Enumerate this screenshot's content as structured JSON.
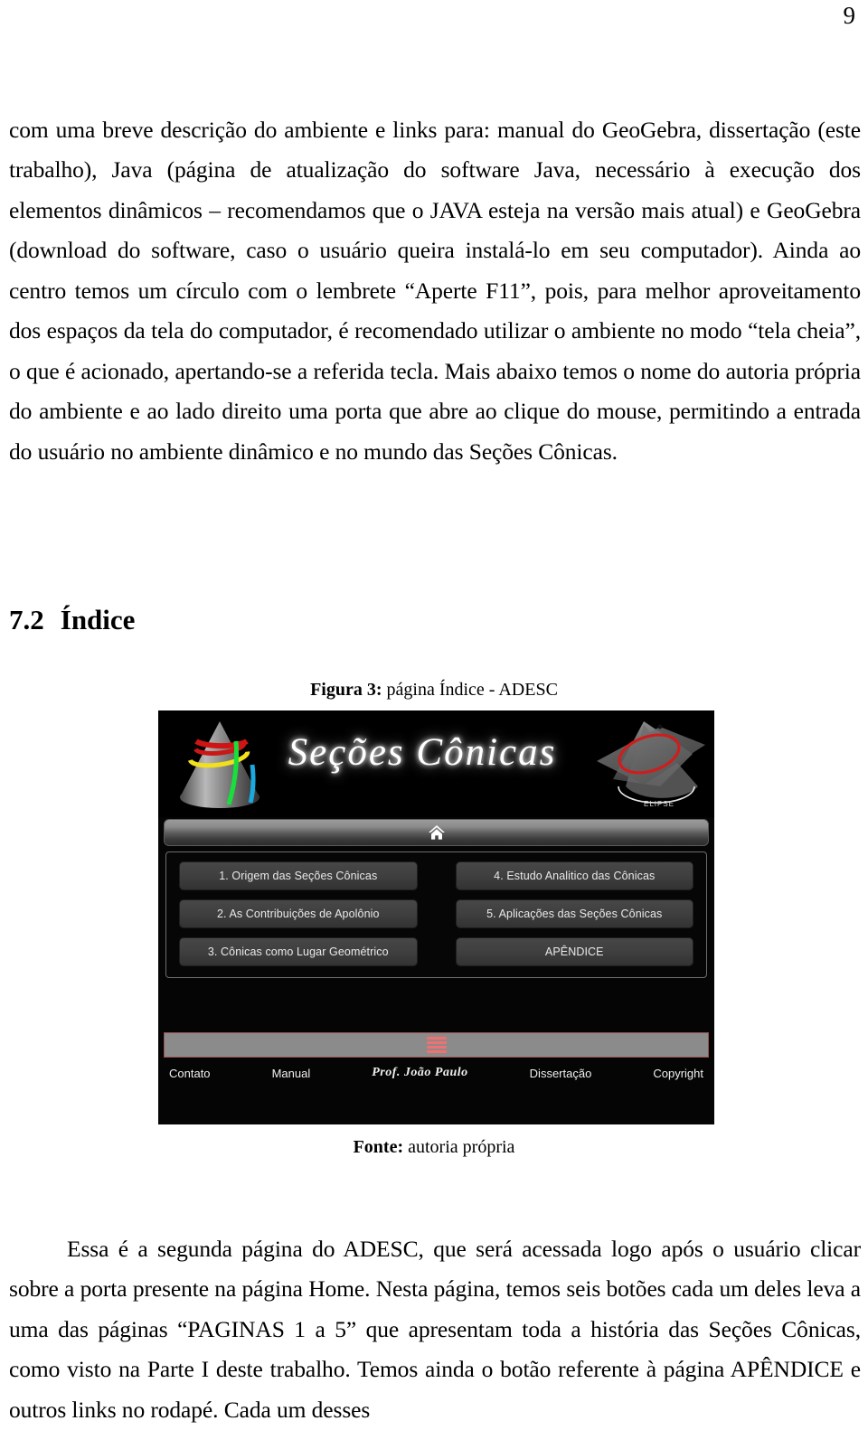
{
  "page": {
    "number": "9"
  },
  "paragraphs": {
    "first": "com uma breve descrição do ambiente e links para: manual do GeoGebra, dissertação (este trabalho), Java (página de atualização do software Java, necessário à execução dos elementos dinâmicos – recomendamos que o JAVA esteja na versão mais atual) e GeoGebra (download do software, caso o usuário queira instalá-lo em seu computador). Ainda ao centro temos um círculo com o lembrete “Aperte F11”, pois, para melhor aproveitamento dos espaços da tela do computador, é recomendado utilizar o ambiente no modo “tela cheia”, o que é acionado, apertando-se a referida tecla. Mais abaixo temos o nome do autoria própria do ambiente e ao lado direito uma porta que abre ao clique do mouse, permitindo a entrada do usuário no ambiente dinâmico e no mundo das Seções Cônicas.",
    "second": "Essa é a segunda página do ADESC, que será acessada logo após o usuário clicar sobre a porta presente na página Home. Nesta página, temos seis botões cada um deles leva a uma das páginas “PAGINAS 1 a 5” que apresentam toda a história das Seções Cônicas, como visto na Parte I deste trabalho. Temos ainda o botão referente à página APÊNDICE e outros links no rodapé. Cada um desses"
  },
  "section": {
    "number": "7.2",
    "title": "Índice"
  },
  "figure": {
    "caption_lead": "Figura 3:",
    "caption_rest": " página Índice - ADESC",
    "source_lead": "Fonte:",
    "source_rest": " autoria própria"
  },
  "screenshot": {
    "banner": {
      "title": "Seções Cônicas",
      "ellipse_label": "ELIPSE",
      "cone_icon": "cone-sections-icon",
      "ellipse_icon": "ellipse-section-icon"
    },
    "home_bar": {
      "icon": "home-icon"
    },
    "menu": {
      "items": [
        "1. Origem das Seções Cônicas",
        "4. Estudo Analitico das Cônicas",
        "2. As Contribuições de Apolônio",
        "5. Aplicações das Seções Cônicas",
        "3. Cônicas como Lugar Geométrico",
        "APÊNDICE"
      ]
    },
    "footer": {
      "stack_icon": "stack-menu-icon",
      "links": [
        "Contato",
        "Manual",
        "Prof. João Paulo",
        "Dissertação",
        "Copyright"
      ]
    },
    "colors": {
      "background": "#050505",
      "button": "#3f3f3f",
      "footer_bar": "#8b8b8b",
      "accent_red": "#f2706f",
      "border": "#6e6e6e"
    }
  }
}
